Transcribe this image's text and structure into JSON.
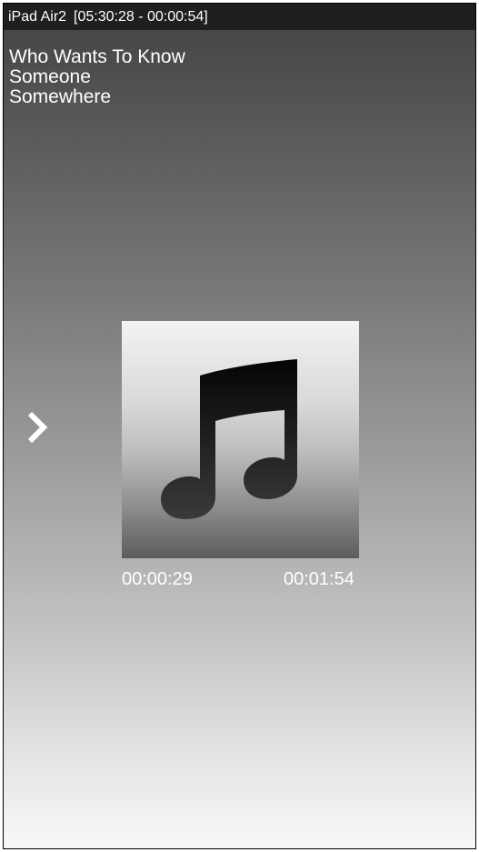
{
  "titlebar": {
    "device": "iPad Air2",
    "session": "[05:30:28 - 00:00:54]"
  },
  "track": {
    "title": "Who Wants To Know",
    "artist": "Someone",
    "album": "Somewhere"
  },
  "player": {
    "elapsed": "00:00:29",
    "total": "00:01:54",
    "next_icon": "chevron-right-icon",
    "artwork_icon": "music-note-icon"
  },
  "colors": {
    "titlebar_bg": "#1f1f1f",
    "text": "#ffffff",
    "gradient_top": "#424242",
    "gradient_bottom": "#f8f8f8"
  }
}
